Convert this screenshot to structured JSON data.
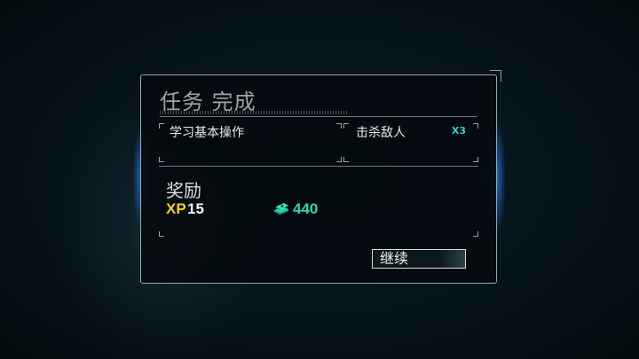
{
  "mission_panel": {
    "title": "任务 完成",
    "objectives": [
      {
        "label": "学习基本操作",
        "count": ""
      },
      {
        "label": "击杀敌人",
        "count": "X3"
      }
    ],
    "rewards": {
      "title": "奖励",
      "xp_label": "XP",
      "xp_value": "15",
      "cash_icon": "cash-stack-icon",
      "cash_value": "440"
    },
    "continue_label": "继续"
  },
  "colors": {
    "xp": "#f2d51c",
    "cash": "#35d4b0",
    "count": "#35d4d0",
    "glow": "#2882ff"
  }
}
